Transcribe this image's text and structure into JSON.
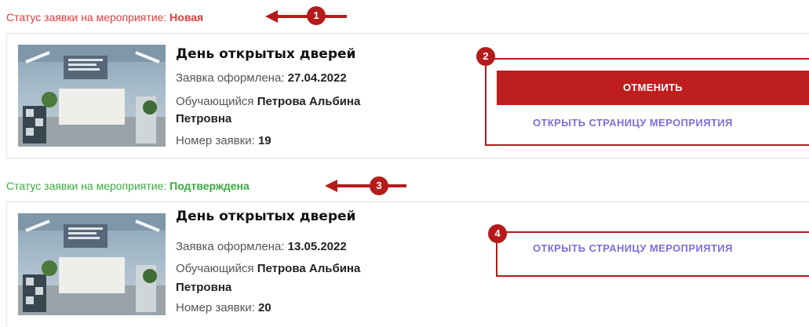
{
  "colors": {
    "status_new": "#e03c3c",
    "status_confirmed": "#3aab3f",
    "cancel_button": "#bf1e1e",
    "link": "#7c6fd8",
    "annotation": "#b51b1b"
  },
  "requests": [
    {
      "status_prefix": "Статус заявки на мероприятие:",
      "status_value": "Новая",
      "event_title": "День открытых дверей",
      "date_label": "Заявка оформлена:",
      "date_value": "27.04.2022",
      "student_label": "Обучающийся",
      "student_name_line1": "Петрова Альбина",
      "student_name_line2": "Петровна",
      "number_label": "Номер заявки:",
      "number_value": "19",
      "cancel_label": "ОТМЕНИТЬ",
      "open_label": "ОТКРЫТЬ СТРАНИЦУ МЕРОПРИЯТИЯ"
    },
    {
      "status_prefix": "Статус заявки на мероприятие:",
      "status_value": "Подтверждена",
      "event_title": "День открытых дверей",
      "date_label": "Заявка оформлена:",
      "date_value": "13.05.2022",
      "student_label": "Обучающийся",
      "student_name_line1": "Петрова Альбина",
      "student_name_line2": "Петровна",
      "number_label": "Номер заявки:",
      "number_value": "20",
      "open_label": "ОТКРЫТЬ СТРАНИЦУ МЕРОПРИЯТИЯ"
    }
  ],
  "annotations": {
    "m1": "1",
    "m2": "2",
    "m3": "3",
    "m4": "4"
  }
}
